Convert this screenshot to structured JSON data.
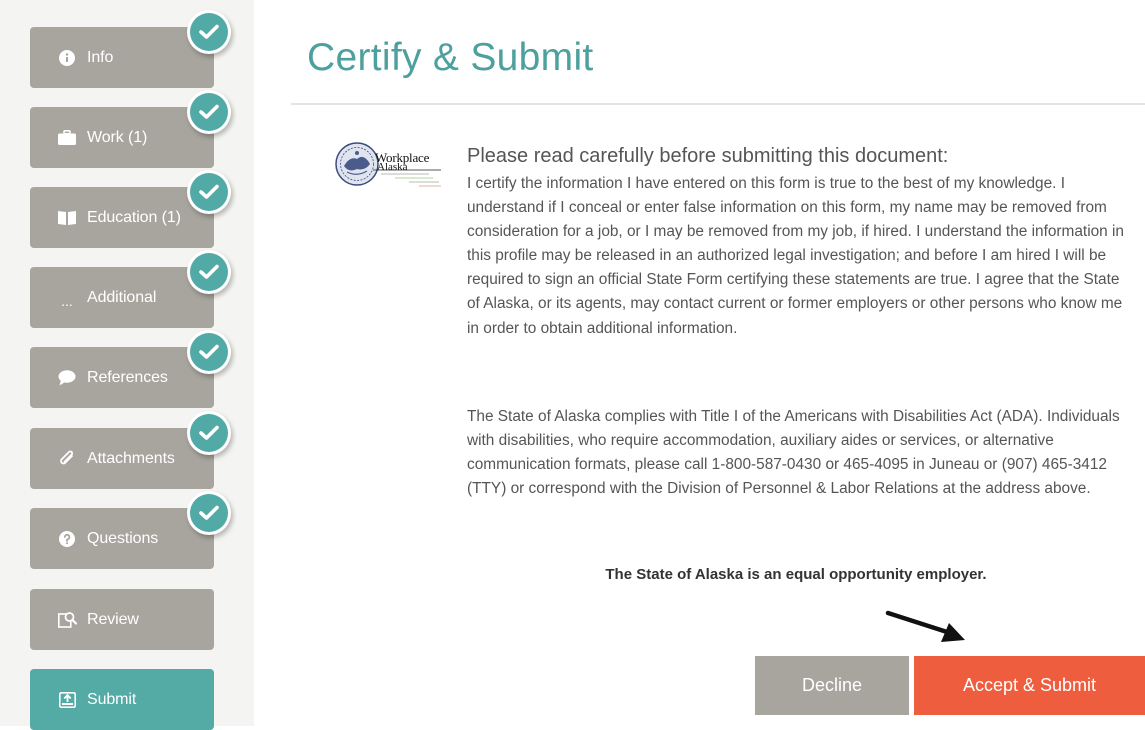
{
  "sidebar": {
    "steps": [
      {
        "label": "Info",
        "icon": "info-icon",
        "completed": true,
        "active": false
      },
      {
        "label": "Work (1)",
        "icon": "briefcase-icon",
        "completed": true,
        "active": false
      },
      {
        "label": "Education (1)",
        "icon": "book-icon",
        "completed": true,
        "active": false
      },
      {
        "label": "Additional",
        "icon": "ellipsis-icon",
        "icon_text": "...",
        "completed": true,
        "active": false
      },
      {
        "label": "References",
        "icon": "speech-bubble-icon",
        "completed": true,
        "active": false
      },
      {
        "label": "Attachments",
        "icon": "paperclip-icon",
        "completed": true,
        "active": false
      },
      {
        "label": "Questions",
        "icon": "question-icon",
        "completed": true,
        "active": false
      },
      {
        "label": "Review",
        "icon": "review-search-icon",
        "completed": false,
        "active": false
      },
      {
        "label": "Submit",
        "icon": "submit-icon",
        "completed": false,
        "active": true
      }
    ]
  },
  "main": {
    "title": "Certify & Submit",
    "logo_text": {
      "line1": "Workplace",
      "line2": "Alaska"
    },
    "heading": "Please read carefully before submitting this document:",
    "paragraph1": "I certify the information I have entered on this form is true to the best of my knowledge. I understand if I conceal or enter false information on this form, my name may be removed from consideration for a job, or I may be removed from my job, if hired. I understand the information in this profile may be released in an authorized legal investigation; and before I am hired I will be required to sign an official State Form certifying these statements are true. I agree that the State of Alaska, or its agents, may contact current or former employers or other persons who know me in order to obtain additional information.",
    "paragraph2": "The State of Alaska complies with Title I of the Americans with Disabilities Act (ADA).  Individuals with disabilities, who require accommodation, auxiliary aides or services, or alternative communication formats, please call 1-800-587-0430 or 465-4095 in Juneau or (907) 465-3412 (TTY) or correspond with the Division of Personnel & Labor Relations at the address above.",
    "eeo_statement": "The State of Alaska is an equal opportunity employer."
  },
  "buttons": {
    "decline": "Decline",
    "accept": "Accept & Submit"
  },
  "colors": {
    "accent": "#4da09d",
    "step_default": "#a8a49e",
    "step_active": "#54aaa4",
    "check": "#52aaa6",
    "accept_button": "#ee5e3e",
    "decline_button": "#a8a49e"
  }
}
